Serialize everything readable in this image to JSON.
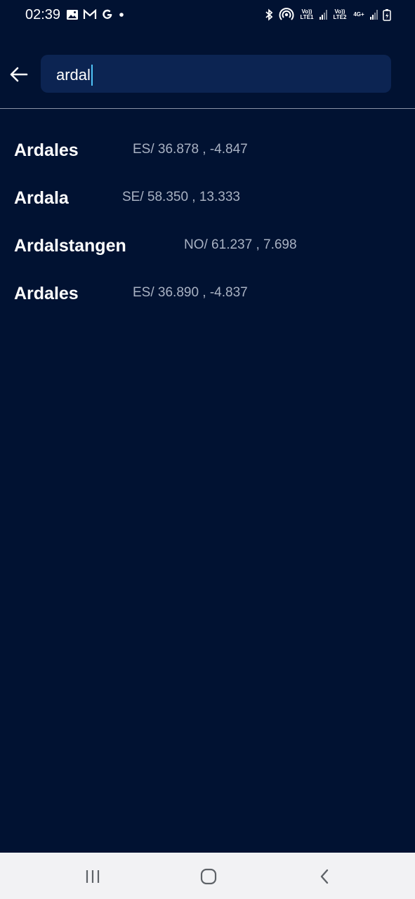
{
  "status": {
    "time": "02:39",
    "sim1_label": "Vo)) LTE1",
    "sim2_label": "Vo)) LTE2",
    "network_type": "4G+"
  },
  "search": {
    "query": "ardal"
  },
  "results": [
    {
      "name": "Ardales",
      "coords": "ES/ 36.878 , -4.847"
    },
    {
      "name": "Ardala",
      "coords": "SE/ 58.350 , 13.333"
    },
    {
      "name": "Ardalstangen",
      "coords": "NO/ 61.237 , 7.698"
    },
    {
      "name": "Ardales",
      "coords": "ES/ 36.890 , -4.837"
    }
  ],
  "colors": {
    "background": "#011232",
    "search_box": "#0c2452",
    "caret": "#4fc3f7",
    "coords_text": "#a9b2c3",
    "nav_bar": "#f2f2f4"
  },
  "icons": {
    "back": "arrow-left-icon",
    "nav_recents": "recents-icon",
    "nav_home": "home-icon",
    "nav_back": "chevron-left-icon"
  }
}
